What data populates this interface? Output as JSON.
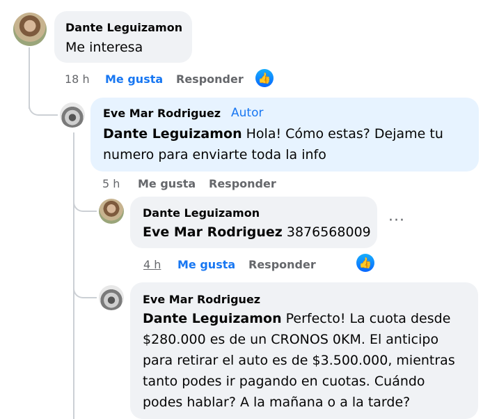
{
  "comment1": {
    "author": "Dante Leguizamon",
    "text": "Me interesa",
    "time": "18 h",
    "like": "Me gusta",
    "reply": "Responder",
    "like_icon": "thumbs-up-icon"
  },
  "reply1": {
    "author": "Eve Mar Rodriguez",
    "badge": "Autor",
    "mention": "Dante Leguizamon",
    "text_line1": " Hola! Cómo estas? Dejame tu",
    "text_line2": "numero para enviarte toda la info",
    "time": "5 h",
    "like": "Me gusta",
    "reply": "Responder"
  },
  "reply2": {
    "author": "Dante Leguizamon",
    "mention": "Eve Mar Rodriguez",
    "text": " 3876568009",
    "time": "4 h",
    "like": "Me gusta",
    "reply": "Responder",
    "more": "···",
    "like_icon": "thumbs-up-icon"
  },
  "reply3": {
    "author": "Eve Mar Rodriguez",
    "mention": "Dante Leguizamon",
    "line1": " Perfecto! La cuota desde",
    "line2": "$280.000 es de un CRONOS 0KM. El anticipo",
    "line3": "para retirar el auto es de $3.500.000, mientras",
    "line4": "tanto podes ir pagando en cuotas. Cuándo",
    "line5": "podes hablar? A la mañana o a la tarde?"
  },
  "colors": {
    "link_blue": "#1877f2",
    "bubble_grey": "#f0f2f5",
    "bubble_blue": "#e7f3ff",
    "meta_grey": "#65676b"
  }
}
